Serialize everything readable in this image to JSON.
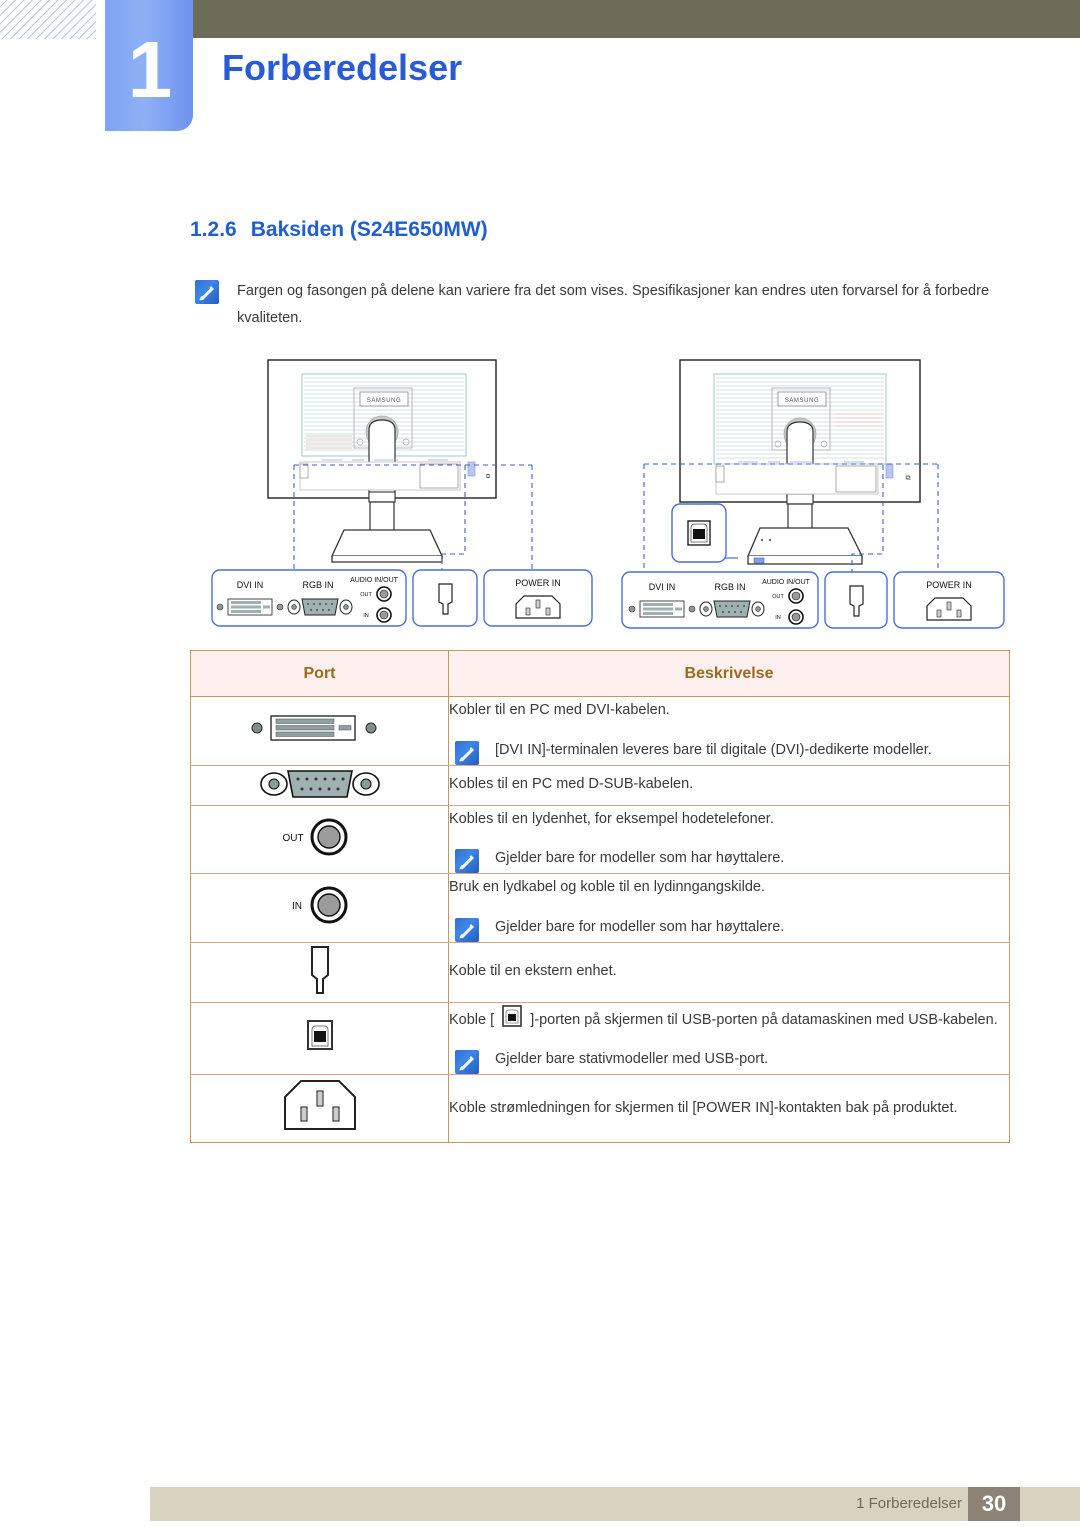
{
  "header": {
    "chapter_number": "1",
    "chapter_title": "Forberedelser",
    "bar_color": "#6d6c58",
    "tab_color": "#7fa4f2",
    "title_color": "#2a5bd7"
  },
  "section": {
    "number": "1.2.6",
    "title": "Baksiden (S24E650MW)",
    "color": "#1f5fd0"
  },
  "note": {
    "icon": "note-pen-icon",
    "text": "Fargen og fasongen på delene kan variere fra det som vises. Spesifikasjoner kan endres uten forvarsel for å forbedre kvaliteten."
  },
  "diagrams": [
    {
      "name": "monitor-rear-view-left",
      "brand_label": "SAMSUNG",
      "callouts": [
        {
          "name": "dvi-in",
          "label": "DVI IN"
        },
        {
          "name": "rgb-in",
          "label": "RGB IN"
        },
        {
          "name": "audio-in-out",
          "label": "AUDIO IN/OUT",
          "sub_labels": [
            "OUT",
            "IN"
          ]
        },
        {
          "name": "external-device",
          "label": ""
        },
        {
          "name": "power-in",
          "label": "POWER IN"
        }
      ]
    },
    {
      "name": "monitor-rear-view-right",
      "brand_label": "SAMSUNG",
      "callouts": [
        {
          "name": "usb-port",
          "label": ""
        },
        {
          "name": "dvi-in",
          "label": "DVI IN"
        },
        {
          "name": "rgb-in",
          "label": "RGB IN"
        },
        {
          "name": "audio-in-out",
          "label": "AUDIO IN/OUT",
          "sub_labels": [
            "OUT",
            "IN"
          ]
        },
        {
          "name": "external-device",
          "label": ""
        },
        {
          "name": "power-in",
          "label": "POWER IN"
        }
      ]
    }
  ],
  "table": {
    "header_bg": "#fdf0ee",
    "header_color": "#9a6b1f",
    "border_color": "#c49a56",
    "row_divider_color": "#e8a183",
    "columns": [
      "Port",
      "Beskrivelse"
    ],
    "rows": [
      {
        "port_icon": "dvi-connector-icon",
        "lines": [
          "Kobler til en PC med DVI-kabelen."
        ],
        "note": "[DVI IN]-terminalen leveres bare til digitale (DVI)-dedikerte modeller."
      },
      {
        "port_icon": "d-sub-connector-icon",
        "lines": [
          "Kobles til en PC med D-SUB-kabelen."
        ],
        "note": ""
      },
      {
        "port_icon": "audio-out-jack-icon",
        "port_label": "OUT",
        "lines": [
          "Kobles til en lydenhet, for eksempel hodetelefoner."
        ],
        "note": "Gjelder bare for modeller som har høyttalere."
      },
      {
        "port_icon": "audio-in-jack-icon",
        "port_label": "IN",
        "lines": [
          "Bruk en lydkabel og koble til en lydinngangskilde."
        ],
        "note": "Gjelder bare for modeller som har høyttalere."
      },
      {
        "port_icon": "external-device-port-icon",
        "lines": [
          "Koble til en ekstern enhet."
        ],
        "note": ""
      },
      {
        "port_icon": "usb-b-port-icon",
        "lines_prefix": "Koble [",
        "lines_suffix": "]-porten på skjermen til USB-porten på datamaskinen med USB-kabelen.",
        "note": "Gjelder bare stativmodeller med USB-port."
      },
      {
        "port_icon": "power-inlet-icon",
        "lines": [
          "Koble strømledningen for skjermen til [POWER IN]-kontakten bak på produktet."
        ],
        "note": ""
      }
    ]
  },
  "footer": {
    "text": "1 Forberedelser",
    "page_number": "30",
    "bar_color": "#d8d3c0",
    "page_box_color": "#8d8276"
  }
}
